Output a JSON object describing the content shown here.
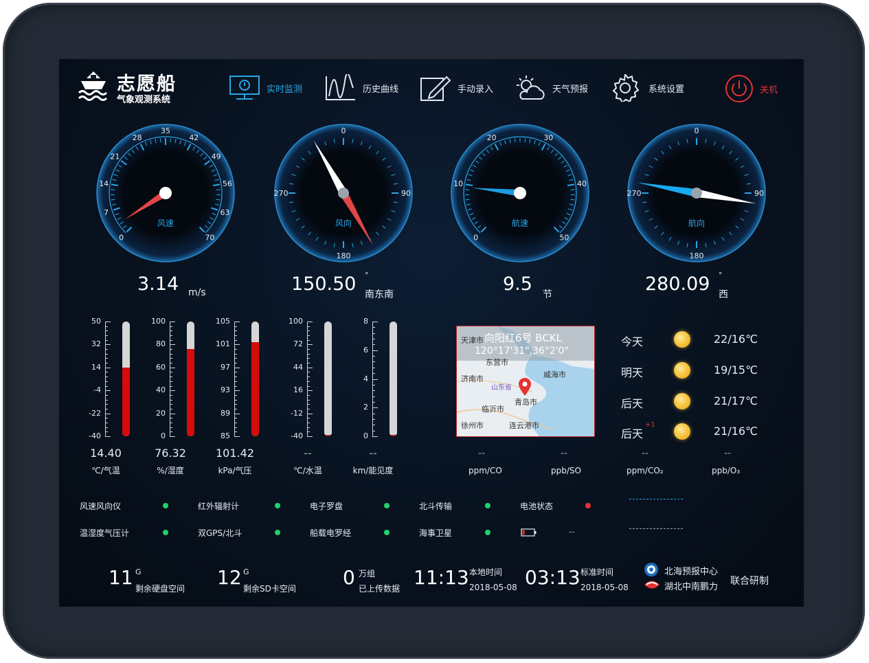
{
  "app": {
    "title": "志愿船",
    "subtitle": "气象观测系统"
  },
  "nav": [
    {
      "label": "实时监测",
      "icon": "monitor-icon",
      "active": true
    },
    {
      "label": "历史曲线",
      "icon": "chart-line-icon"
    },
    {
      "label": "手动录入",
      "icon": "pen-icon"
    },
    {
      "label": "天气预报",
      "icon": "weather-icon"
    },
    {
      "label": "系统设置",
      "icon": "gear-icon"
    },
    {
      "label": "关机",
      "icon": "power-icon"
    }
  ],
  "gauges": {
    "wind_speed": {
      "label": "风速",
      "value": "3.14",
      "unit": "m/s",
      "ticks": [
        "0",
        "7",
        "14",
        "21",
        "28",
        "35",
        "42",
        "49",
        "56",
        "63",
        "70"
      ],
      "needle_value": 3.14
    },
    "wind_dir": {
      "label": "风向",
      "value": "150.50",
      "unit": "南东南",
      "degree_symbol": "°",
      "ticks": [
        "0",
        "90",
        "180",
        "270"
      ],
      "needle_value": 150.5
    },
    "ship_speed": {
      "label": "航速",
      "value": "9.5",
      "unit": "节",
      "ticks": [
        "0",
        "10",
        "20",
        "30",
        "40",
        "50"
      ],
      "needle_value": 9.5
    },
    "heading": {
      "label": "航向",
      "value": "280.09",
      "unit": "西",
      "degree_symbol": "°",
      "ticks": [
        "0",
        "90",
        "180",
        "270"
      ],
      "needle_value": 280.09
    }
  },
  "thermometers": [
    {
      "ticks": [
        "50",
        "32",
        "14",
        "-4",
        "-22",
        "-40"
      ],
      "value": "14.40",
      "label": "℃/气温",
      "level": 0.6
    },
    {
      "ticks": [
        "100",
        "80",
        "60",
        "40",
        "20",
        "0"
      ],
      "value": "76.32",
      "label": "%/湿度",
      "level": 0.76
    },
    {
      "ticks": [
        "105",
        "101",
        "97",
        "93",
        "89",
        "85"
      ],
      "value": "101.42",
      "label": "kPa/气压",
      "level": 0.82
    },
    {
      "ticks": [
        "100",
        "72",
        "44",
        "16",
        "-12",
        "-40"
      ],
      "value": "--",
      "label": "℃/水温",
      "level": 0.0
    },
    {
      "ticks": [
        "8",
        "6",
        "4",
        "2",
        "0"
      ],
      "value": "--",
      "label": "km/能见度",
      "level": 0.0
    }
  ],
  "map": {
    "title": "向阳红6号 BCKL",
    "coords": "120°17'31\",36°2'0\"",
    "places": [
      "天津市",
      "东营市",
      "济南市",
      "威海市",
      "山东省",
      "青岛市",
      "临沂市",
      "徐州市",
      "连云港市"
    ]
  },
  "gases": [
    {
      "value": "--",
      "label": "ppm/CO"
    },
    {
      "value": "--",
      "label": "ppb/SO"
    },
    {
      "value": "--",
      "label": "ppm/CO₂"
    },
    {
      "value": "--",
      "label": "ppb/O₃"
    }
  ],
  "weather": [
    {
      "day": "今天",
      "temp": "22/16℃"
    },
    {
      "day": "明天",
      "temp": "19/15℃"
    },
    {
      "day": "后天",
      "temp": "21/17℃"
    },
    {
      "day": "后天",
      "sup": "+1",
      "temp": "21/16℃"
    }
  ],
  "status": [
    {
      "label": "风速风向仪",
      "state": "ok"
    },
    {
      "label": "红外辐射计",
      "state": "ok"
    },
    {
      "label": "电子罗盘",
      "state": "ok"
    },
    {
      "label": "北斗传输",
      "state": "ok"
    },
    {
      "label": "电池状态",
      "state": "error"
    },
    {
      "label": "温湿度气压计",
      "state": "ok"
    },
    {
      "label": "双GPS/北斗",
      "state": "ok"
    },
    {
      "label": "船载电罗经",
      "state": "ok"
    },
    {
      "label": "海事卫星",
      "state": "ok"
    },
    {
      "label": "--",
      "state": "battery"
    }
  ],
  "footer": {
    "disk": {
      "value": "11",
      "unit": "G",
      "label": "剩余硬盘空间"
    },
    "sd": {
      "value": "12",
      "unit": "G",
      "label": "剩余SD卡空间"
    },
    "uploaded": {
      "value": "0",
      "unit": "万组",
      "label": "已上传数据"
    },
    "local": {
      "time": "11:13",
      "label": "本地时间",
      "date": "2018-05-08"
    },
    "utc": {
      "time": "03:13",
      "label": "标准时间",
      "date": "2018-05-08"
    },
    "orgs": [
      "北海预报中心",
      "湖北中南鹏力"
    ],
    "joint": "联合研制"
  },
  "colors": {
    "accent": "#2aa6e6",
    "alarm": "#e53333",
    "ok": "#1fd36a",
    "mercury": "#d60b0b"
  }
}
